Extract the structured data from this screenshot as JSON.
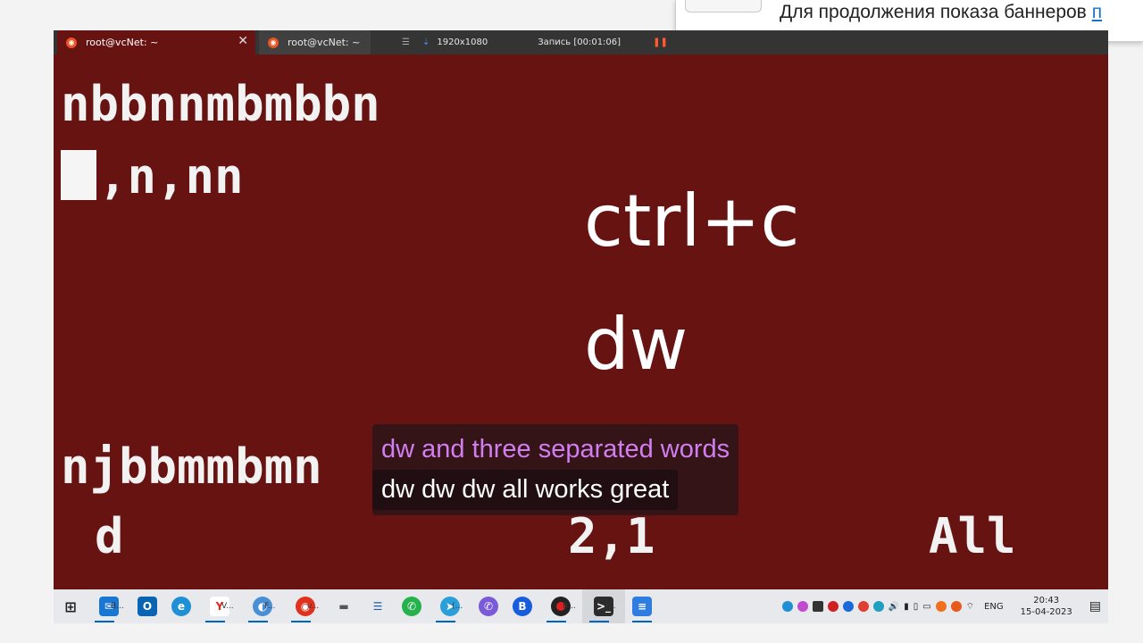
{
  "terminal": {
    "tabs": [
      {
        "title": "root@vcNet: ~",
        "active": true
      },
      {
        "title": "root@vcNet: ~",
        "active": false
      }
    ],
    "close_glyph": "✕",
    "lines": {
      "line1": "nbbnnmbmbbn",
      "line2": ",n,nn",
      "line3": "njbbmmbmn",
      "mode": "d",
      "position": "2,1",
      "scroll": "All"
    },
    "background": "#661312"
  },
  "recorder": {
    "resolution": "1920x1080",
    "record_label": "Запись [00:01:06]"
  },
  "overlay": {
    "key1": "ctrl+c",
    "key2": "dw"
  },
  "caption": {
    "line1": "dw and three separated words",
    "line2": "dw dw dw all works great"
  },
  "banner": {
    "text": "Для продолжения показа баннеров",
    "link": "п"
  },
  "taskbar": {
    "items": [
      {
        "icon": "windows-start-icon",
        "label": ""
      },
      {
        "icon": "mail-icon",
        "label": "B..."
      },
      {
        "icon": "outlook-icon",
        "label": ""
      },
      {
        "icon": "edge-icon",
        "label": ""
      },
      {
        "icon": "yandex-icon",
        "label": "V..."
      },
      {
        "icon": "firefox-icon",
        "label": "F..."
      },
      {
        "icon": "vivaldi-icon",
        "label": "v..."
      },
      {
        "icon": "usb-icon",
        "label": ""
      },
      {
        "icon": "task-manager-icon",
        "label": ""
      },
      {
        "icon": "whatsapp-icon",
        "label": ""
      },
      {
        "icon": "telegram-icon",
        "label": "(..."
      },
      {
        "icon": "viber-icon",
        "label": ""
      },
      {
        "icon": "bitwarden-icon",
        "label": ""
      },
      {
        "icon": "recorder-icon",
        "label": "B..."
      },
      {
        "icon": "terminal-icon",
        "label": "r..."
      },
      {
        "icon": "document-icon",
        "label": ""
      }
    ],
    "language": "ENG",
    "time": "20:43",
    "date": "15-04-2023"
  }
}
